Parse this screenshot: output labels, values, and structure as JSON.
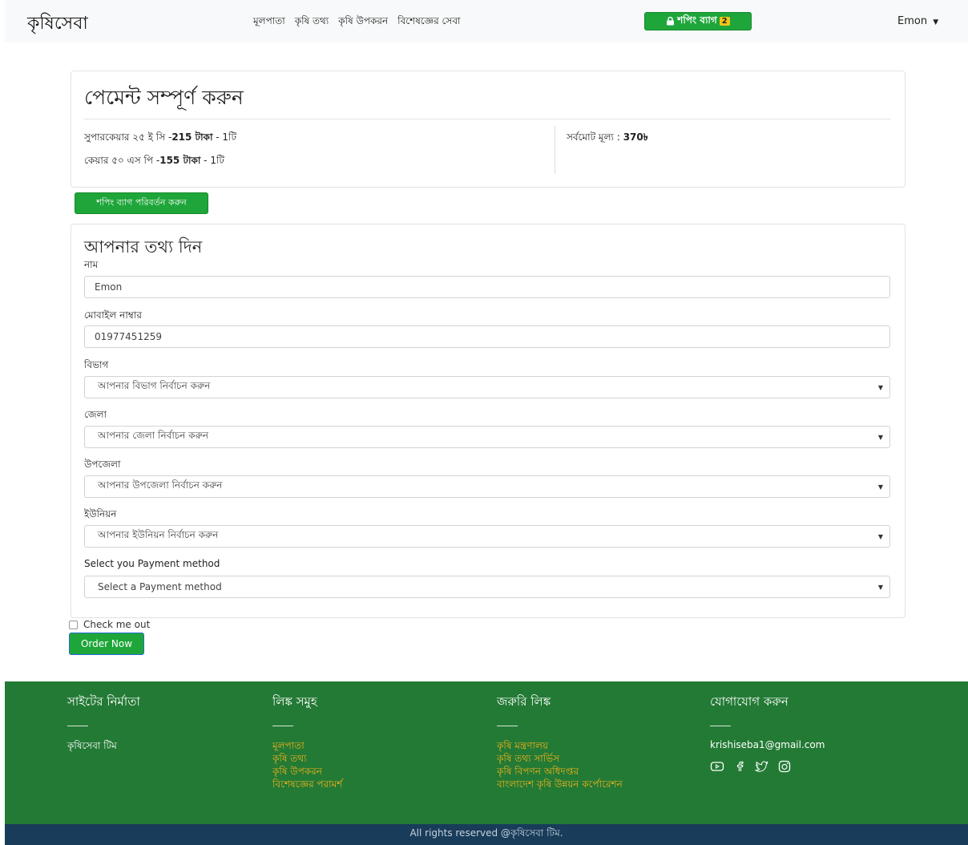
{
  "navbar": {
    "brand": "কৃষিসেবা",
    "links": [
      "মূলপাতা",
      "কৃষি তথ্য",
      "কৃষি উপকরন",
      "বিশেষজ্ঞের সেবা"
    ],
    "cart_label": "শপিং ব্যাগ",
    "cart_count": "2",
    "user": "Emon"
  },
  "payment": {
    "title": "পেমেন্ট সম্পূর্ণ করুন",
    "items": [
      {
        "name": "সুপারকেয়ার ২৫ ই সি -",
        "price": "215 টাকা",
        "qty": " - 1টি"
      },
      {
        "name": "কেয়ার ৫০ এস পি -",
        "price": "155 টাকা",
        "qty": " - 1টি"
      }
    ],
    "total_label": "সর্বমোট মূল্য : ",
    "total_value": "370৳",
    "change_bag_button": "শপিং ব্যাগ পরিবর্তন করুন"
  },
  "form": {
    "title": "আপনার তথ্য দিন",
    "name_label": "নাম",
    "name_value": "Emon",
    "mobile_label": "মোবাইল নাম্বার",
    "mobile_value": "01977451259",
    "division_label": "বিভাগ",
    "division_value": "আপনার বিভাগ নির্বাচন করুন",
    "district_label": "জেলা",
    "district_value": "আপনার জেলা নির্বাচন করুন",
    "upazila_label": "উপজেলা",
    "upazila_value": "আপনার উপজেলা নির্বাচন করুন",
    "union_label": "ইউনিয়ন",
    "union_value": "আপনার ইউনিয়ন নির্বাচন করুন",
    "payment_label": "Select you Payment method",
    "payment_value": "Select a Payment method",
    "checkbox_label": "Check me out",
    "order_button": "Order Now"
  },
  "footer": {
    "col1_title": "সাইটের নির্মাতা",
    "col1_text": "কৃষিসেবা টিম",
    "col2_title": "লিঙ্ক সমুহ",
    "col2_links": [
      "মূলপাতা",
      "কৃষি তথ্য",
      "কৃষি উপকরন",
      "বিশেষজ্ঞের পরামর্শ"
    ],
    "col3_title": "জরুরি লিঙ্ক",
    "col3_links": [
      "কৃষি মন্ত্রণালয়",
      "কৃষি তথ্য সার্ভিস",
      "কৃষি বিপণন অধিদপ্তর",
      "বাংলাদেশ কৃষি উন্নয়ন কর্পোরেশন"
    ],
    "col4_title": "যোগাযোগ করুন",
    "email": "krishiseba1@gmail.com",
    "social_icons": [
      "youtube-icon",
      "facebook-icon",
      "twitter-icon",
      "instagram-icon"
    ],
    "copyright": "All rights reserved @কৃষিসেবা টিম."
  },
  "colors": {
    "accent_green": "#1fa63a",
    "footer_green": "#237a35",
    "footer_bottom": "#183c5a",
    "link_yellow": "#f3b21b"
  }
}
